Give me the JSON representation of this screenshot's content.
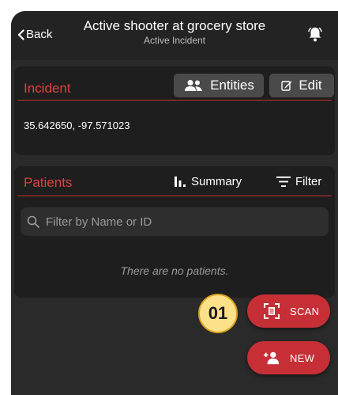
{
  "header": {
    "back_label": "Back",
    "title": "Active shooter at grocery store",
    "subtitle": "Active Incident",
    "bell_icon": "bell-icon"
  },
  "incident": {
    "title": "Incident",
    "entities_label": "Entities",
    "edit_label": "Edit",
    "coordinates": "35.642650, -97.571023"
  },
  "patients": {
    "title": "Patients",
    "summary_label": "Summary",
    "filter_label": "Filter",
    "search_placeholder": "Filter by Name or ID",
    "empty_text": "There are no patients."
  },
  "actions": {
    "scan_label": "SCAN",
    "new_label": "NEW"
  },
  "annotation": {
    "badge": "01"
  },
  "colors": {
    "accent_red": "#e0413c",
    "fab_red": "#c62f36",
    "badge_yellow": "#fde18a"
  }
}
